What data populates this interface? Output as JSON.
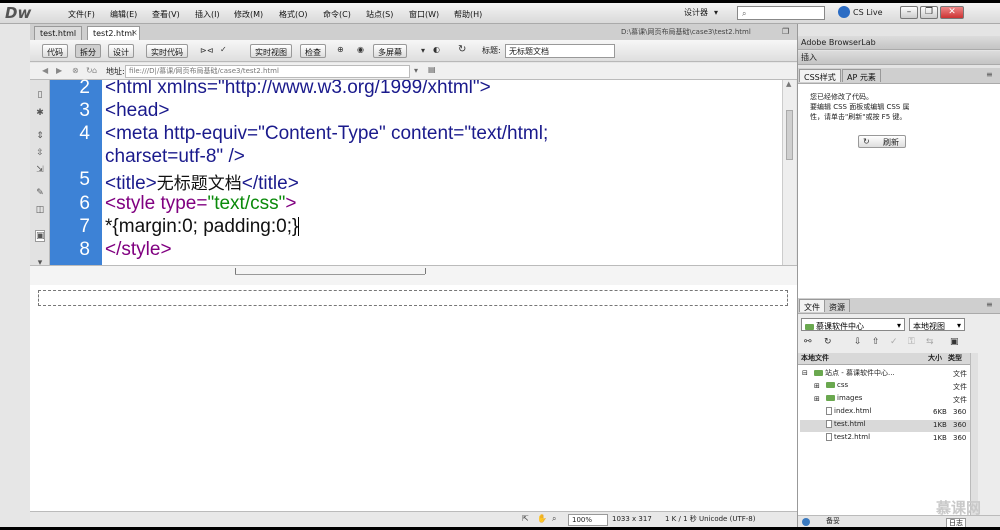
{
  "app": {
    "logo": "Dw"
  },
  "menu": [
    "文件(F)",
    "编辑(E)",
    "查看(V)",
    "插入(I)",
    "修改(M)",
    "格式(O)",
    "命令(C)",
    "站点(S)",
    "窗口(W)",
    "帮助(H)"
  ],
  "menu_right": {
    "workspace": "设计器",
    "cslive": "CS Live"
  },
  "tabs": [
    "test.html",
    "test2.html"
  ],
  "doc_path": "D:\\慕课\\网页布局基础\\case3\\test2.html",
  "toolbar": {
    "code": "代码",
    "split": "拆分",
    "design": "设计",
    "live_code": "实时代码",
    "live_view": "实时视图",
    "inspect": "检查",
    "multiscreen": "多屏幕",
    "title_label": "标题:",
    "title_value": "无标题文档"
  },
  "address": {
    "label": "地址:",
    "value": "file:///D|/慕课/网页布局基础/case3/test2.html"
  },
  "code_lines": [
    {
      "n": "2",
      "text": "<html xmlns=\"http://www.w3.org/1999/xhtml\">"
    },
    {
      "n": "3",
      "text": "<head>"
    },
    {
      "n": "4",
      "text": "<meta http-equiv=\"Content-Type\" content=\"text/html;"
    },
    {
      "n": "",
      "text": "charset=utf-8\" />"
    },
    {
      "n": "5",
      "pre": "<title>",
      "cjk": "无标题文档",
      "post": "</title>"
    },
    {
      "n": "6",
      "pre": "<style type=",
      "str": "\"text/css\"",
      "post": ">"
    },
    {
      "n": "7",
      "text": "*{margin:0; padding:0;}"
    },
    {
      "n": "8",
      "text": "</style>"
    }
  ],
  "status": {
    "zoom": "100%",
    "size": "1033 x 317",
    "doc": "1 K / 1 秒 Unicode (UTF-8)"
  },
  "right_panel": {
    "header": "Adobe BrowserLab",
    "insert_tab": "插入",
    "css_tab": "CSS样式",
    "ap_tab": "AP 元素",
    "message": [
      "您已经修改了代码。",
      "要编辑 CSS 面板或编辑 CSS 属",
      "性，请单击\"刷新\"或按 F5 键。"
    ],
    "refresh": "刷新",
    "files_tab": "文件",
    "assets_tab": "资源",
    "site_select": "慕课软件中心",
    "view_select": "本地视图",
    "col_local": "本地文件",
    "col_size": "大小",
    "col_type": "类型",
    "rows": [
      {
        "name": "站点 - 慕课软件中心...",
        "size": "",
        "type": "文件",
        "kind": "site"
      },
      {
        "name": "css",
        "size": "",
        "type": "文件",
        "kind": "folder"
      },
      {
        "name": "images",
        "size": "",
        "type": "文件",
        "kind": "folder"
      },
      {
        "name": "index.html",
        "size": "6KB",
        "type": "360",
        "kind": "page"
      },
      {
        "name": "test.html",
        "size": "1KB",
        "type": "360",
        "kind": "page"
      },
      {
        "name": "test2.html",
        "size": "1KB",
        "type": "360",
        "kind": "page"
      }
    ],
    "log": "日志"
  },
  "watermark": "慕课网",
  "colors": {
    "gutter": "#3d82d6",
    "tag": "#1a1a8c",
    "style_tag": "#800080",
    "string": "#0a8a0a"
  }
}
